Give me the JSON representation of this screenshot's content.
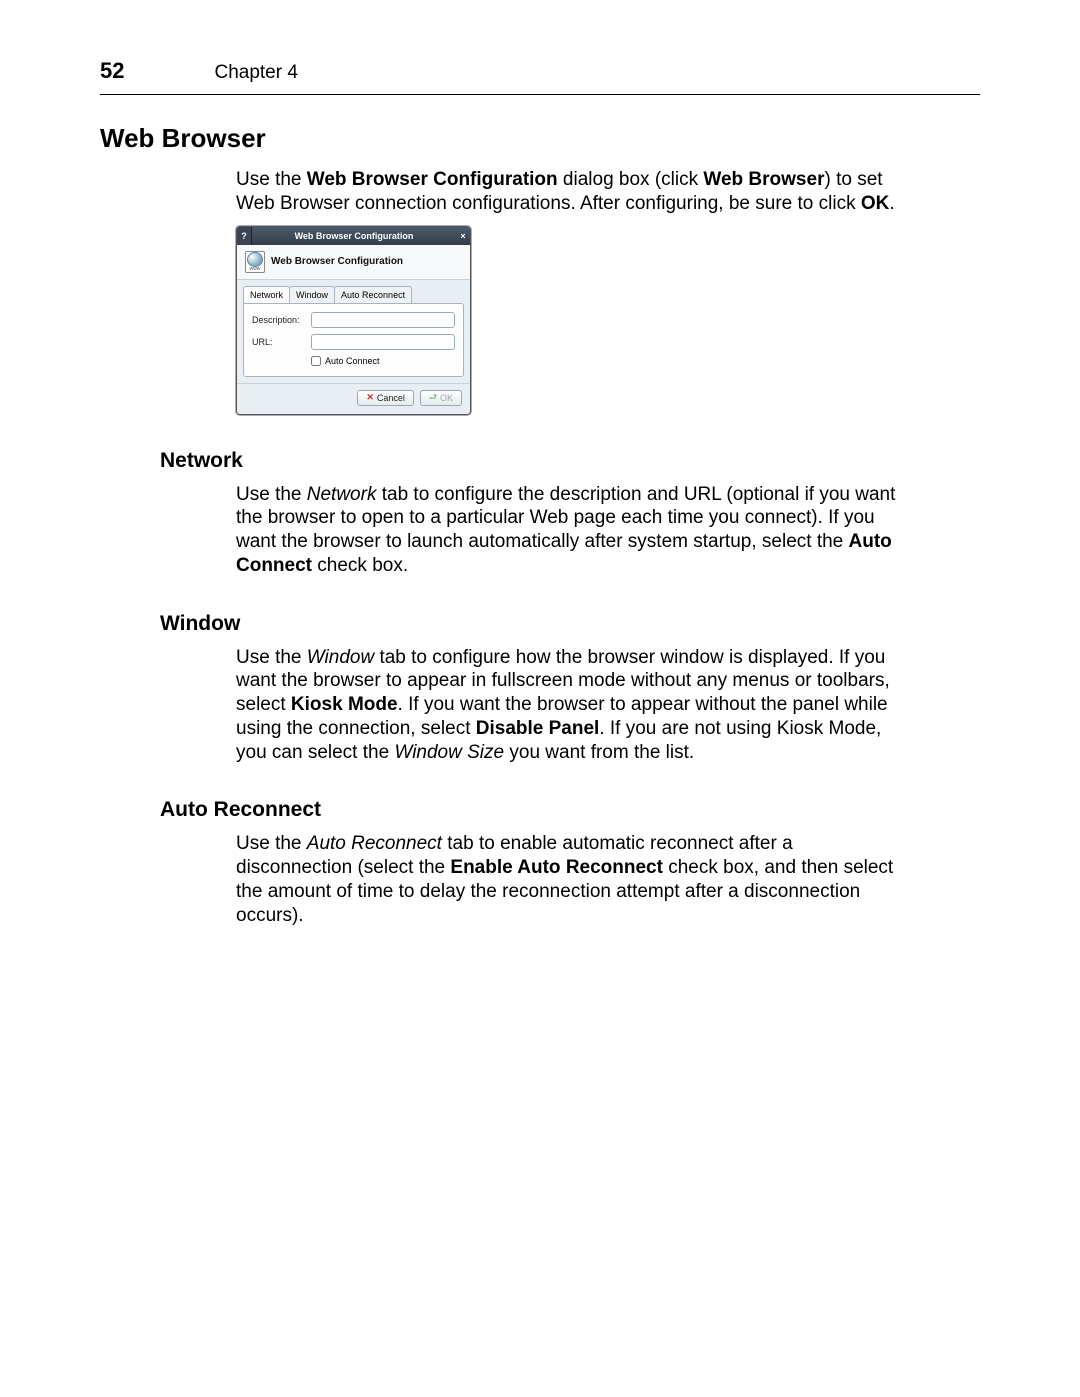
{
  "header": {
    "page_number": "52",
    "chapter_label": "Chapter 4"
  },
  "section_title": "Web Browser",
  "intro": {
    "t1": "Use the ",
    "b1": "Web Browser Configuration",
    "t2": " dialog box (click ",
    "b2": "Web Browser",
    "t3": ") to set Web Browser connection configurations. After configuring, be sure to click ",
    "b3": "OK",
    "t4": "."
  },
  "dialog": {
    "titlebar": "Web Browser Configuration",
    "help_glyph": "?",
    "close_glyph": "×",
    "icon_caption": "www",
    "header_text": "Web Browser Configuration",
    "tabs": {
      "network": "Network",
      "window": "Window",
      "auto_reconnect": "Auto Reconnect"
    },
    "form": {
      "description_label": "Description:",
      "url_label": "URL:",
      "auto_connect_label": "Auto Connect"
    },
    "buttons": {
      "cancel": "Cancel",
      "ok": "OK"
    }
  },
  "network": {
    "heading": "Network",
    "t1": "Use the ",
    "i1": "Network",
    "t2": " tab to configure the description and URL (optional if you want the browser to open to a particular Web page each time you connect). If you want the browser to launch automatically after system startup, select the ",
    "b1": "Auto Connect",
    "t3": " check box."
  },
  "window": {
    "heading": "Window",
    "t1": "Use the ",
    "i1": "Window",
    "t2": " tab to configure how the browser window is displayed. If you want the browser to appear in fullscreen mode without any menus or toolbars, select ",
    "b1": "Kiosk Mode",
    "t3": ". If you want the browser to appear without the panel while using the connection, select ",
    "b2": "Disable Panel",
    "t4": ". If you are not using Kiosk Mode, you can select the ",
    "i2": "Window Size",
    "t5": " you want from the list."
  },
  "auto_reconnect": {
    "heading": "Auto Reconnect",
    "t1": "Use the ",
    "i1": "Auto Reconnect",
    "t2": " tab to enable automatic reconnect after a disconnection (select the ",
    "b1": "Enable Auto Reconnect",
    "t3": " check box, and then select the amount of time to delay the reconnection attempt after a disconnection occurs)."
  }
}
